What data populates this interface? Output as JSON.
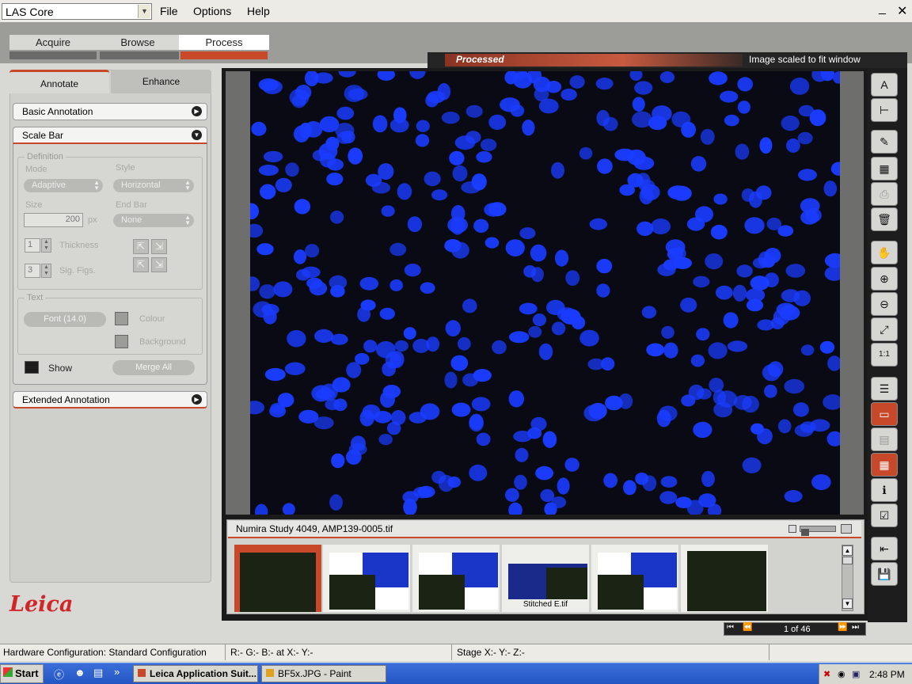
{
  "app": {
    "selector": "LAS Core"
  },
  "menu": {
    "file": "File",
    "options": "Options",
    "help": "Help"
  },
  "window": {
    "minimize": "_",
    "close": "✕"
  },
  "workflow": {
    "acquire": "Acquire",
    "browse": "Browse",
    "process": "Process",
    "active": "Process"
  },
  "panel_tabs": {
    "annotate": "Annotate",
    "enhance": "Enhance"
  },
  "sections": {
    "basic": "Basic Annotation",
    "scale": "Scale Bar",
    "extended": "Extended Annotation"
  },
  "scalebar": {
    "definition": "Definition",
    "mode_label": "Mode",
    "mode_value": "Adaptive",
    "style_label": "Style",
    "style_value": "Horizontal",
    "size_label": "Size",
    "size_value": "200",
    "size_unit": "px",
    "endbar_label": "End Bar",
    "endbar_value": "None",
    "thickness_value": "1",
    "thickness_label": "Thickness",
    "sigfigs_value": "3",
    "sigfigs_label": "Sig. Figs.",
    "text": "Text",
    "font_button": "Font (14.0)",
    "colour_label": "Colour",
    "background_label": "Background",
    "show_label": "Show",
    "merge_button": "Merge All"
  },
  "viewer": {
    "processed_label": "Processed",
    "scale_info": "Image scaled to fit window",
    "study_title": "Numira Study 4049, AMP139-0005.tif",
    "thumb_label": "Stitched E.tif",
    "pager": "1 of 46"
  },
  "status": {
    "hardware": "Hardware Configuration: Standard Configuration",
    "rgb": "R:-  G:-  B:-  at  X:-  Y:-",
    "stage": "Stage X:-  Y:-  Z:-"
  },
  "taskbar": {
    "start": "Start",
    "task1": "Leica Application Suit...",
    "task2": "BF5x.JPG - Paint",
    "clock": "2:48 PM"
  },
  "logo": "Leica",
  "colors": {
    "accent": "#c8482a",
    "nucleus": "#1a3cff"
  }
}
